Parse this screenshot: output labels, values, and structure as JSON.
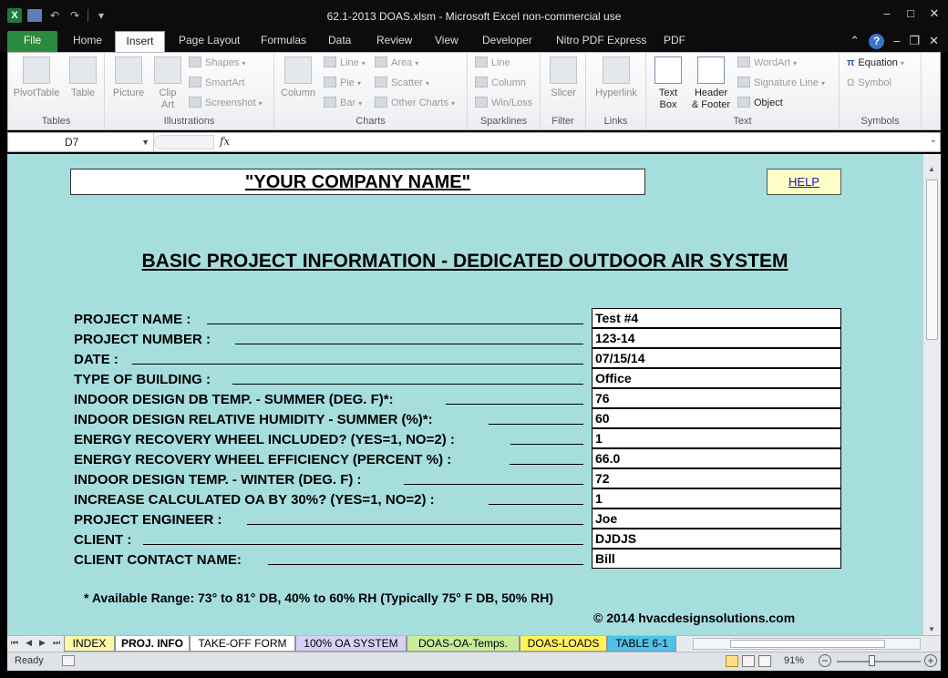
{
  "window": {
    "title": "62.1-2013 DOAS.xlsm  -  Microsoft Excel non-commercial use"
  },
  "ribbon_tabs": [
    {
      "label": "File"
    },
    {
      "label": "Home"
    },
    {
      "label": "Insert"
    },
    {
      "label": "Page Layout"
    },
    {
      "label": "Formulas"
    },
    {
      "label": "Data"
    },
    {
      "label": "Review"
    },
    {
      "label": "View"
    },
    {
      "label": "Developer"
    },
    {
      "label": "Nitro PDF Express"
    },
    {
      "label": "PDF"
    }
  ],
  "active_tab": "Insert",
  "ribbon": {
    "tables": {
      "label": "Tables",
      "pivot": "PivotTable",
      "table": "Table"
    },
    "illustrations": {
      "label": "Illustrations",
      "picture": "Picture",
      "clipart_1": "Clip",
      "clipart_2": "Art",
      "shapes": "Shapes",
      "smartart": "SmartArt",
      "screenshot": "Screenshot"
    },
    "charts": {
      "label": "Charts",
      "column": "Column",
      "line": "Line",
      "pie": "Pie",
      "bar": "Bar",
      "area": "Area",
      "scatter": "Scatter",
      "other": "Other Charts"
    },
    "sparklines": {
      "label": "Sparklines",
      "line": "Line",
      "column": "Column",
      "winloss": "Win/Loss"
    },
    "filter": {
      "label": "Filter",
      "slicer": "Slicer"
    },
    "links": {
      "label": "Links",
      "hyperlink": "Hyperlink"
    },
    "text": {
      "label": "Text",
      "textbox_1": "Text",
      "textbox_2": "Box",
      "header_1": "Header",
      "header_2": "& Footer",
      "wordart": "WordArt",
      "signature": "Signature Line",
      "object": "Object"
    },
    "symbols": {
      "label": "Symbols",
      "equation": "Equation",
      "symbol": "Symbol"
    }
  },
  "formula_bar": {
    "name_box": "D7",
    "fx": "fx",
    "formula": ""
  },
  "sheet": {
    "company": "\"YOUR COMPANY NAME\"",
    "help": "HELP",
    "heading": "BASIC PROJECT INFORMATION - DEDICATED OUTDOOR AIR SYSTEM",
    "fields": [
      {
        "label": "PROJECT NAME :",
        "value": "Test #4"
      },
      {
        "label": "PROJECT NUMBER :",
        "value": "123-14"
      },
      {
        "label": "DATE :",
        "value": "07/15/14"
      },
      {
        "label": "TYPE OF BUILDING :",
        "value": "Office"
      },
      {
        "label": "INDOOR DESIGN DB TEMP. - SUMMER (DEG. F)*:",
        "value": "76"
      },
      {
        "label": "INDOOR DESIGN RELATIVE HUMIDITY - SUMMER (%)*:",
        "value": "60"
      },
      {
        "label": "ENERGY RECOVERY WHEEL INCLUDED? (YES=1, NO=2) :",
        "value": "1"
      },
      {
        "label": "ENERGY RECOVERY WHEEL EFFICIENCY (PERCENT %) :",
        "value": "66.0"
      },
      {
        "label": "INDOOR DESIGN TEMP. - WINTER (DEG. F) :",
        "value": "72"
      },
      {
        "label": "INCREASE CALCULATED OA BY 30%?  (YES=1, NO=2) :",
        "value": "1"
      },
      {
        "label": "PROJECT ENGINEER :",
        "value": "Joe"
      },
      {
        "label": "CLIENT :",
        "value": "DJDJS"
      },
      {
        "label": "CLIENT CONTACT NAME:",
        "value": "Bill"
      }
    ],
    "note": "* Available Range:  73° to 81° DB, 40% to 60% RH (Typically 75° F DB, 50% RH)",
    "copyright": "© 2014 hvacdesignsolutions.com",
    "background_color": "#a6dedd"
  },
  "sheet_tabs": [
    {
      "label": "INDEX",
      "color": "#fdf7a8"
    },
    {
      "label": "PROJ. INFO",
      "color": "#ffffff"
    },
    {
      "label": "TAKE-OFF FORM",
      "color": "#ffffff"
    },
    {
      "label": "100% OA SYSTEM",
      "color": "#d9d0f3"
    },
    {
      "label": "DOAS-OA-Temps.",
      "color": "#c8ec9c"
    },
    {
      "label": "DOAS-LOADS",
      "color": "#fff25a"
    },
    {
      "label": "TABLE 6-1",
      "color": "#4fc2ec"
    }
  ],
  "status_bar": {
    "ready": "Ready",
    "zoom": "91%"
  }
}
